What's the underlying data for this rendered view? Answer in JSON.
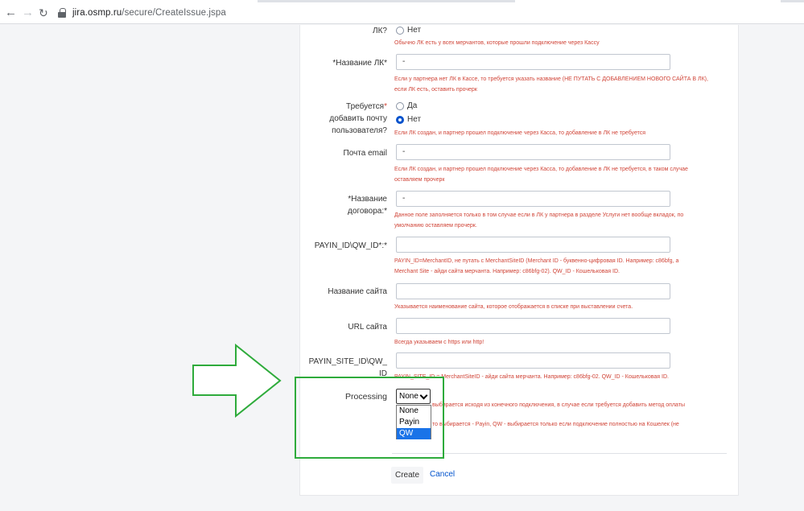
{
  "browser": {
    "url_host": "jira.osmp.ru",
    "url_path": "/secure/CreateIssue.jspa",
    "back_icon": "arrow-left-icon",
    "forward_icon": "arrow-right-icon",
    "reload_icon": "reload-icon",
    "lock_icon": "lock-icon"
  },
  "form": {
    "lk_question": {
      "label": "ЛК?",
      "option_no": "Нет",
      "hint": "Обычно ЛК есть у всех мерчантов, которые прошли подключение через Кассу"
    },
    "lk_name": {
      "label": "*Название ЛК*",
      "value": "-",
      "hint_1": "Если у партнера нет ЛК в Кассе, то требуется указать название (НЕ ПУТАТЬ С ДОБАВЛЕНИЕМ НОВОГО САЙТА В ЛК),",
      "hint_2": "если ЛК есть, оставить прочерк"
    },
    "add_email": {
      "label_1": "Требуется",
      "label_2": "добавить почту",
      "label_3": "пользователя?",
      "option_yes": "Да",
      "option_no": "Нет",
      "selected": "Нет",
      "hint": "Если ЛК создан, и партнер прошел подключение через Касса, то добавление в ЛК не требуется"
    },
    "email": {
      "label": "Почта email",
      "value": "-",
      "hint_1": "Если ЛК создан, и партнер прошел подключение через Касса, то добавление в ЛК не требуется, в таком случае",
      "hint_2": "оставляем прочерк"
    },
    "contract_name": {
      "label_1": "*Название",
      "label_2": "договора:*",
      "value": "-",
      "hint_1": "Данное поле заполняется только в том случае если в ЛК у партнера в разделе Услуги нет вообще вкладок, по",
      "hint_2": "умолчанию оставляем прочерк."
    },
    "payin_id": {
      "label": "PAYIN_ID\\QW_ID*:*",
      "value": "",
      "hint_1": "PAYIN_ID=MerchantID, не путать с MerchantSiteID (Merchant ID - буквенно-цифровая ID. Например: c86bfg, а",
      "hint_2": "Merchant Site - айди сайта мерчанта. Например: c86bfg-02). QW_ID - Кошельковая ID."
    },
    "site_name": {
      "label": "Название сайта",
      "value": "",
      "hint": "Указывается наименование сайта, которое отображается в списке при выставлении счета."
    },
    "site_url": {
      "label": "URL сайта",
      "value": "",
      "hint": "Всегда указываем с https или http!"
    },
    "payin_site_id": {
      "label_1": "PAYIN_SITE_ID\\QW_",
      "label_2": "ID",
      "value": "",
      "hint": "PAYIN_SITE_ID = MerchantSiteID - айди сайта мерчанта. Например: c86bfg-02. QW_ID - Кошельковая ID."
    },
    "processing": {
      "label": "Processing",
      "selected": "None",
      "options": [
        "None",
        "Payin",
        "QW"
      ],
      "highlighted": "QW",
      "hint_1": "выбирается исходя из конечного подключения, в случае если требуется добавить метод оплаты",
      "hint_2": "то выбирается - Payin, QW - выбирается только если подключение полностью на Кошелек (не"
    },
    "create_label": "Create",
    "cancel_label": "Cancel"
  },
  "annotations": {
    "arrow_color": "#2eab3b",
    "box_color": "#2eab3b"
  }
}
